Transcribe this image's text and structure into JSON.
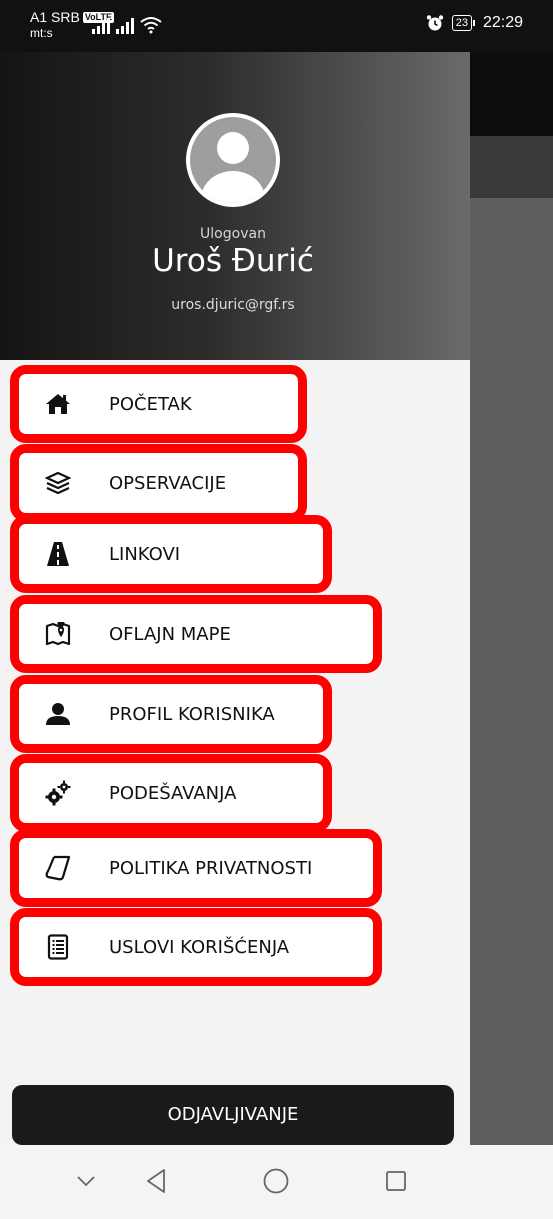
{
  "status_bar": {
    "carrier": "A1 SRB",
    "volte": "VoLTE",
    "carrier_sub": "mt:s",
    "battery": "23",
    "time": "22:29"
  },
  "drawer": {
    "status": "Ulogovan",
    "user_name": "Uroš Đurić",
    "email": "uros.djuric@rgf.rs",
    "menu": [
      {
        "label": "POČETAK",
        "icon": "home-icon"
      },
      {
        "label": "OPSERVACIJE",
        "icon": "layers-icon"
      },
      {
        "label": "LINKOVI",
        "icon": "road-icon"
      },
      {
        "label": "OFLAJN MAPE",
        "icon": "map-marker-icon"
      },
      {
        "label": "PROFIL KORISNIKA",
        "icon": "user-icon"
      },
      {
        "label": "PODEŠAVANJA",
        "icon": "gears-icon"
      },
      {
        "label": "POLITIKA PRIVATNOSTI",
        "icon": "document-curl-icon"
      },
      {
        "label": "USLOVI KORIŠĆENJA",
        "icon": "list-document-icon"
      }
    ],
    "logout_label": "ODJAVLJIVANJE"
  },
  "colors": {
    "highlight": "#ff0000",
    "header_dark": "#141414",
    "drawer_bg": "#f3f3f3"
  }
}
